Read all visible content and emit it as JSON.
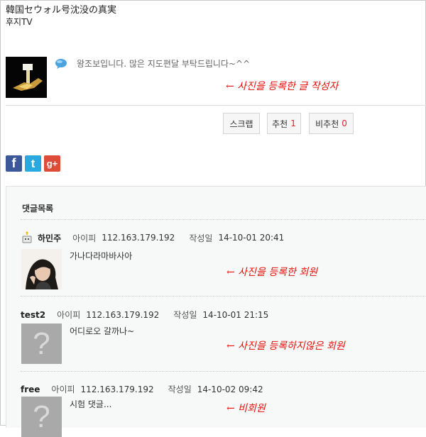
{
  "post": {
    "title": "韓国セウォル号沈没の真実",
    "subtitle": "후지TV",
    "body": "왕조보입니다. 많은 지도편달 부탁드립니다~^^"
  },
  "annotations": {
    "post_author": "← 사진을 등록한 글 작성자",
    "photo_member": "← 사진을 등록한 회원",
    "no_photo_member": "← 사진을 등록하지않은 회원",
    "non_member": "← 비회원"
  },
  "actions": {
    "scrap_label": "스크랩",
    "recommend_label": "추천",
    "recommend_count": "1",
    "not_recommend_label": "비추천",
    "not_recommend_count": "0"
  },
  "share": {
    "facebook": "f",
    "twitter": "t",
    "googleplus": "g+",
    "colors": {
      "facebook": "#3b5998",
      "twitter": "#2aa9e0",
      "googleplus": "#dd4b39"
    }
  },
  "comments": {
    "heading": "댓글목록",
    "ip_label": "아이피",
    "date_label": "작성일",
    "items": [
      {
        "nickname": "하민주",
        "ip": "112.163.179.192",
        "date": "14-10-01 20:41",
        "text": "가나다라마바사아"
      },
      {
        "nickname": "test2",
        "ip": "112.163.179.192",
        "date": "14-10-01 21:15",
        "text": "어디로오 갈까나~"
      },
      {
        "nickname": "free",
        "ip": "112.163.179.192",
        "date": "14-10-02 09:42",
        "text": "시험 댓글..."
      }
    ]
  },
  "colors": {
    "count_red": "#e0242a",
    "annotation_red": "#e8120c"
  }
}
